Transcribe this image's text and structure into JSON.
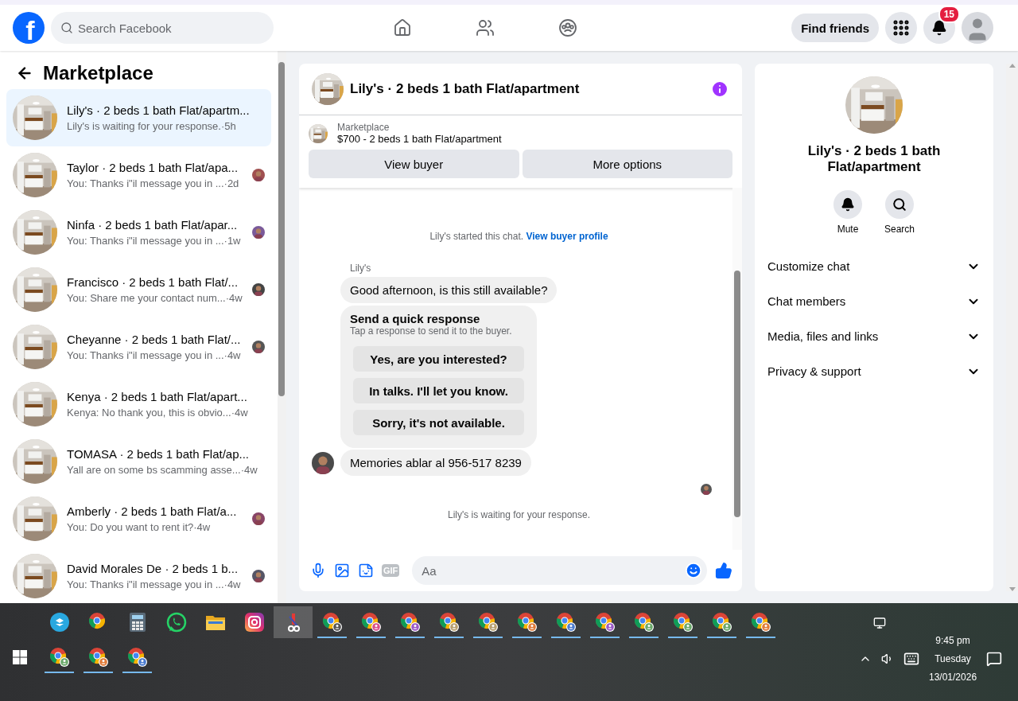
{
  "topbar": {
    "logo": "f",
    "search": {
      "placeholder": "Search Facebook"
    },
    "find_friends": "Find friends",
    "notifications": "15"
  },
  "sidebar": {
    "title": "Marketplace",
    "conversations": [
      {
        "title": "Lily's · 2 beds 1 bath Flat/apartm...",
        "preview": "Lily's is waiting for your response.",
        "time": "·5h",
        "selected": true,
        "seen": false
      },
      {
        "title": "Taylor · 2 beds 1 bath Flat/apa...",
        "preview": "You: Thanks i\"il message you in ...",
        "time": " ·2d",
        "selected": false,
        "seen": true
      },
      {
        "title": "Ninfa · 2 beds 1 bath Flat/apar...",
        "preview": "You: Thanks i\"il message you in ...",
        "time": "·1w",
        "selected": false,
        "seen": true
      },
      {
        "title": "Francisco · 2 beds 1 bath Flat/...",
        "preview": "You: Share me your contact num...",
        "time": "·4w",
        "selected": false,
        "seen": true
      },
      {
        "title": "Cheyanne · 2 beds 1 bath Flat/...",
        "preview": "You: Thanks i\"il message you in ...",
        "time": "·4w",
        "selected": false,
        "seen": true
      },
      {
        "title": "Kenya · 2 beds 1 bath Flat/apart...",
        "preview": "Kenya: No thank you, this is obvio...",
        "time": " ·4w",
        "selected": false,
        "seen": false
      },
      {
        "title": "TOMASA · 2 beds 1 bath Flat/ap...",
        "preview": "Yall are on some bs scamming asse...",
        "time": "·4w",
        "selected": false,
        "seen": false
      },
      {
        "title": "Amberly · 2 beds 1 bath Flat/a...",
        "preview": "You: Do you want to rent it?",
        "time": "·4w",
        "selected": false,
        "seen": true
      },
      {
        "title": "David Morales De · 2 beds 1 b...",
        "preview": "You: Thanks i\"il message you in ...",
        "time": "·4w",
        "selected": false,
        "seen": true
      }
    ]
  },
  "chat": {
    "title": "Lily's · 2 beds 1 bath Flat/apartment",
    "listing_label": "Marketplace",
    "listing": "$700 - 2 beds 1 bath Flat/apartment",
    "buttons": [
      "View buyer",
      "More options"
    ],
    "started": "Lily's started this chat.",
    "profile_link": "View buyer profile",
    "sender": "Lily's",
    "message": "Good afternoon, is this still available?",
    "quick_response": {
      "title": "Send a quick response",
      "subtitle": "Tap a response to send it to the buyer.",
      "options": [
        "Yes, are you interested?",
        "In talks. I'll let you know.",
        "Sorry, it's not available."
      ]
    },
    "last_message": "Memories ablar al 956-517 8239",
    "status": "Lily's is waiting for your response.",
    "composer": {
      "gif": "GIF",
      "placeholder": "Aa"
    }
  },
  "details": {
    "title": "Lily's · 2 beds 1 bath Flat/apartment",
    "actions": [
      {
        "kind": "mute",
        "label": "Mute"
      },
      {
        "kind": "search",
        "label": "Search"
      }
    ],
    "sections": [
      {
        "label": "Customize chat",
        "expanded": false
      },
      {
        "label": "Chat members",
        "expanded": false
      },
      {
        "label": "Media, files and links",
        "expanded": false
      },
      {
        "label": "Privacy & support",
        "expanded": false
      }
    ]
  },
  "taskbar": {
    "rows": [
      [
        {
          "kind": "dropbox",
          "running": false
        },
        {
          "kind": "chrome",
          "running": false
        },
        {
          "kind": "calculator",
          "running": false
        },
        {
          "kind": "whatsapp",
          "running": false
        },
        {
          "kind": "folder",
          "running": false
        },
        {
          "kind": "instagram",
          "running": false
        },
        {
          "kind": "tool",
          "running": false
        },
        {
          "kind": "chrome",
          "running": true,
          "color": "#555555"
        },
        {
          "kind": "chrome",
          "running": true,
          "color": "#d94f8a"
        },
        {
          "kind": "chrome",
          "running": true,
          "color": "#9b59c6"
        },
        {
          "kind": "chrome",
          "running": true,
          "color": "#b8a070"
        },
        {
          "kind": "chrome",
          "running": true,
          "color": "#b8a070"
        },
        {
          "kind": "chrome",
          "running": true,
          "color": "#e07b39"
        },
        {
          "kind": "chrome",
          "running": true,
          "color": "#4a7bd0"
        },
        {
          "kind": "chrome",
          "running": true,
          "color": "#9b59c6"
        },
        {
          "kind": "chrome",
          "running": true,
          "color": "#6aa86a"
        },
        {
          "kind": "chrome",
          "running": true,
          "color": "#6aa86a"
        },
        {
          "kind": "chrome",
          "running": true,
          "color": "#6aa86a"
        },
        {
          "kind": "chrome",
          "running": true,
          "color": "#e07b39"
        }
      ],
      [
        {
          "kind": "chrome",
          "running": true,
          "color": "#6aa86a"
        },
        {
          "kind": "chrome",
          "running": true,
          "color": "#e07b39"
        },
        {
          "kind": "chrome",
          "running": true,
          "color": "#4a7bd0"
        }
      ]
    ],
    "time": "9:45 pm",
    "day": "Tuesday",
    "date": "13/01/2026"
  }
}
